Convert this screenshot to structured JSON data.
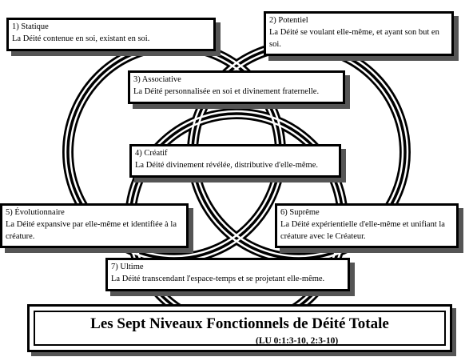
{
  "diagram": {
    "levels": [
      {
        "title": "1) Statique",
        "desc": "La Déité contenue en soi, existant en soi."
      },
      {
        "title": "2) Potentiel",
        "desc": "La Déité se voulant elle-même, et ayant son but en soi."
      },
      {
        "title": "3) Associative",
        "desc": "La Déité  personnalisée en soi et divinement fraternelle."
      },
      {
        "title": "4) Créatif",
        "desc": "La Déité divinement révélée, distributive d'elle-même."
      },
      {
        "title": "5) Évolutionnaire",
        "desc": "La Déité expansive par elle-même et identifiée à la créature."
      },
      {
        "title": "6) Suprême",
        "desc": "La Déité expérientielle d'elle-même et unifiant la créature avec le Créateur."
      },
      {
        "title": "7) Ultime",
        "desc": "La Déité transcendant l'espace-temps et se projetant elle-même."
      }
    ],
    "title": "Les Sept Niveaux Fonctionnels de Déité Totale",
    "reference": "(LU 0:1:3-10, 2:3-10)"
  }
}
